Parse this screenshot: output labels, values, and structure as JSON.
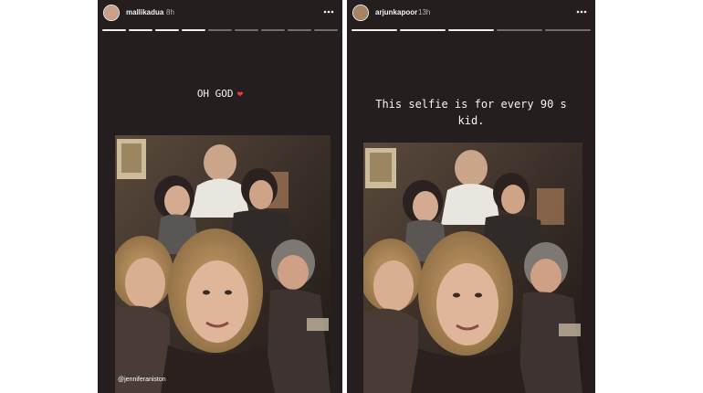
{
  "stories": {
    "left": {
      "username": "mallikadua",
      "time": "8h",
      "caption": "OH GOD",
      "caption_emoji": "❤",
      "mention": "@jenniferaniston",
      "segments_total": 9,
      "segments_completed": 4,
      "avatar_color": "#c9a08a"
    },
    "right": {
      "username": "arjunkapoor",
      "time": "13h",
      "caption": "This selfie is for every 90 s kid.",
      "segments_total": 5,
      "segments_completed": 3,
      "avatar_color": "#a88262"
    }
  },
  "colors": {
    "story_background": "#241f1e",
    "progress_done": "#ffffff",
    "heart": "#ed3b3b"
  },
  "icons": [
    "more-options-icon",
    "heart-emoji"
  ]
}
